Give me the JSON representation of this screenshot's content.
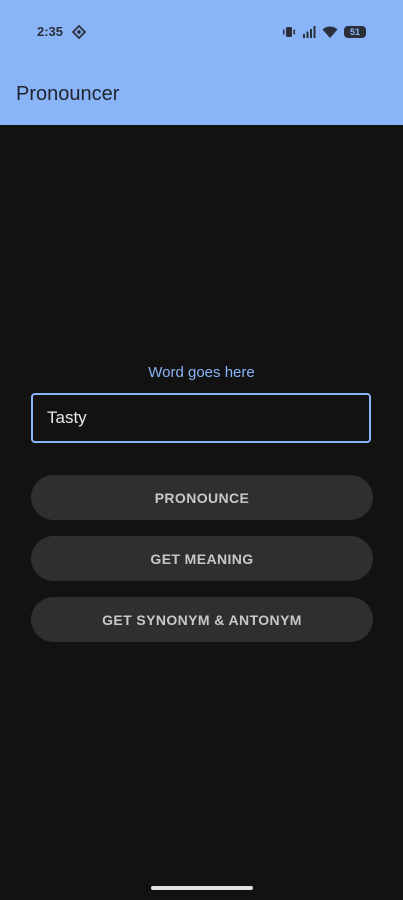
{
  "status_bar": {
    "time": "2:35",
    "battery_level": "51",
    "icons": [
      "diamond-icon",
      "vibrate-icon",
      "signal-icon",
      "wifi-icon",
      "battery-icon"
    ]
  },
  "app_bar": {
    "title": "Pronouncer",
    "background": "#8ab4f8"
  },
  "form": {
    "label": "Word goes here",
    "input_value": "Tasty"
  },
  "buttons": {
    "pronounce": "PRONOUNCE",
    "meaning": "GET MEANING",
    "synonym": "GET SYNONYM & ANTONYM"
  },
  "colors": {
    "accent": "#8ab4f8",
    "background": "#121212",
    "button": "#2f2f2f"
  }
}
